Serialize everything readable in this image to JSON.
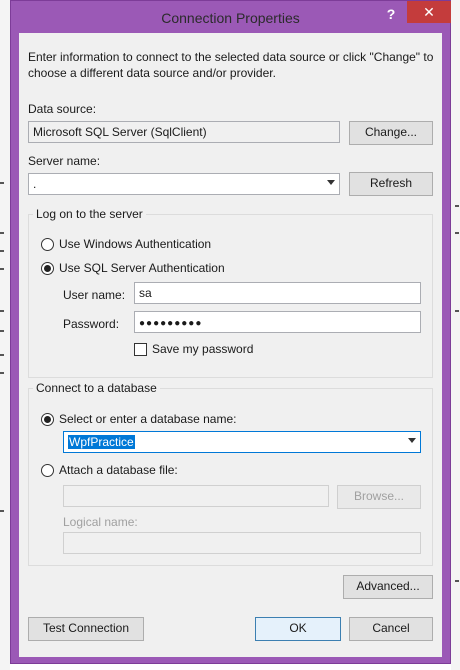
{
  "window": {
    "title": "Connection Properties",
    "help_symbol": "?",
    "close_symbol": "✕"
  },
  "intro": {
    "line1": "Enter information to connect to the selected data source or click \"Change\" to",
    "line2": "choose a different data source and/or provider."
  },
  "data_source": {
    "label": "Data source:",
    "value": "Microsoft SQL Server (SqlClient)",
    "change_label": "Change..."
  },
  "server": {
    "label": "Server name:",
    "value": ".",
    "refresh_label": "Refresh"
  },
  "logon": {
    "group_label": "Log on to the server",
    "windows_auth_label": "Use Windows Authentication",
    "sql_auth_label": "Use SQL Server Authentication",
    "username_label": "User name:",
    "username_value": "sa",
    "password_label": "Password:",
    "password_value": "●●●●●●●●●",
    "save_password_label": "Save my password"
  },
  "database": {
    "group_label": "Connect to a database",
    "select_label": "Select or enter a database name:",
    "selected_db": "WpfPractice",
    "attach_label": "Attach a database file:",
    "attach_value": "",
    "browse_label": "Browse...",
    "logical_name_label": "Logical name:",
    "logical_name_value": ""
  },
  "footer": {
    "advanced_label": "Advanced...",
    "test_label": "Test Connection",
    "ok_label": "OK",
    "cancel_label": "Cancel"
  },
  "colors": {
    "frame": "#9b59b6",
    "close": "#c43c3c",
    "selection": "#0078d7"
  }
}
